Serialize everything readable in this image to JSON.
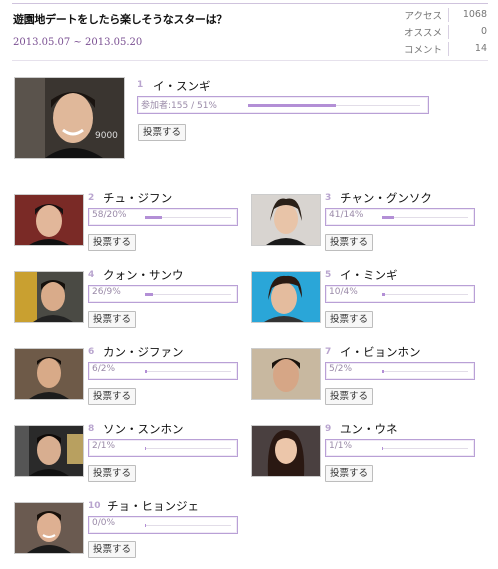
{
  "poll": {
    "title": "遊園地デートをしたら楽しそうなスターは？",
    "period": "2013.05.07 ~ 2013.05.20",
    "stats": [
      {
        "label": "アクセス",
        "value": "1068"
      },
      {
        "label": "オススメ",
        "value": "0"
      },
      {
        "label": "コメント",
        "value": "14"
      }
    ]
  },
  "top": {
    "rank": "1",
    "name": "イ・スンギ",
    "bar_text": "参加者:155 / 51%",
    "percent": 51,
    "vote_label": "投票する",
    "photo_text": "9000"
  },
  "candidates": [
    {
      "rank": "2",
      "name": "チュ・ジフン",
      "bar_text": "58/20%",
      "percent": 20,
      "vote_label": "投票する"
    },
    {
      "rank": "3",
      "name": "チャン・グンソク",
      "bar_text": "41/14%",
      "percent": 14,
      "vote_label": "投票する"
    },
    {
      "rank": "4",
      "name": "クォン・サンウ",
      "bar_text": "26/9%",
      "percent": 9,
      "vote_label": "投票する"
    },
    {
      "rank": "5",
      "name": "イ・ミンギ",
      "bar_text": "10/4%",
      "percent": 4,
      "vote_label": "投票する"
    },
    {
      "rank": "6",
      "name": "カン・ジファン",
      "bar_text": "6/2%",
      "percent": 2,
      "vote_label": "投票する"
    },
    {
      "rank": "7",
      "name": "イ・ビョンホン",
      "bar_text": "5/2%",
      "percent": 2,
      "vote_label": "投票する"
    },
    {
      "rank": "8",
      "name": "ソン・スンホン",
      "bar_text": "2/1%",
      "percent": 1,
      "vote_label": "投票する"
    },
    {
      "rank": "9",
      "name": "ユン・ウネ",
      "bar_text": "1/1%",
      "percent": 1,
      "vote_label": "投票する"
    },
    {
      "rank": "10",
      "name": "チョ・ヒョンジェ",
      "bar_text": "0/0%",
      "percent": 0,
      "vote_label": "投票する"
    }
  ],
  "colors": {
    "accent": "#b38fd6",
    "border": "#b9a0d6",
    "period": "#7a4f92"
  }
}
